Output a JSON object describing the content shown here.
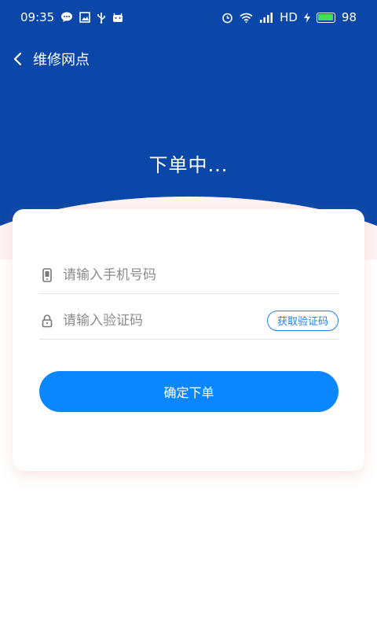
{
  "status_bar": {
    "time": "09:35",
    "network": "HD",
    "battery_level": "98",
    "left_icons": [
      "message-bubble-icon",
      "image-icon",
      "usb-icon",
      "android-icon"
    ],
    "right_icons": [
      "alarm-icon",
      "wifi-icon",
      "signal-icon",
      "charging-icon",
      "battery-icon"
    ]
  },
  "nav": {
    "back_icon": "chevron-left-icon",
    "title": "维修网点"
  },
  "hero": {
    "headline": "下单中..."
  },
  "form": {
    "phone": {
      "icon": "phone-icon",
      "placeholder": "请输入手机号码",
      "value": ""
    },
    "code": {
      "icon": "lock-icon",
      "placeholder": "请输入验证码",
      "value": "",
      "get_code_label": "获取验证码"
    },
    "submit_label": "确定下单"
  },
  "colors": {
    "hero_bg": "#0b47a8",
    "accent": "#0a87ff",
    "link": "#1e80ee",
    "battery": "#3ee059",
    "page_tint": "#fdf3f2"
  }
}
